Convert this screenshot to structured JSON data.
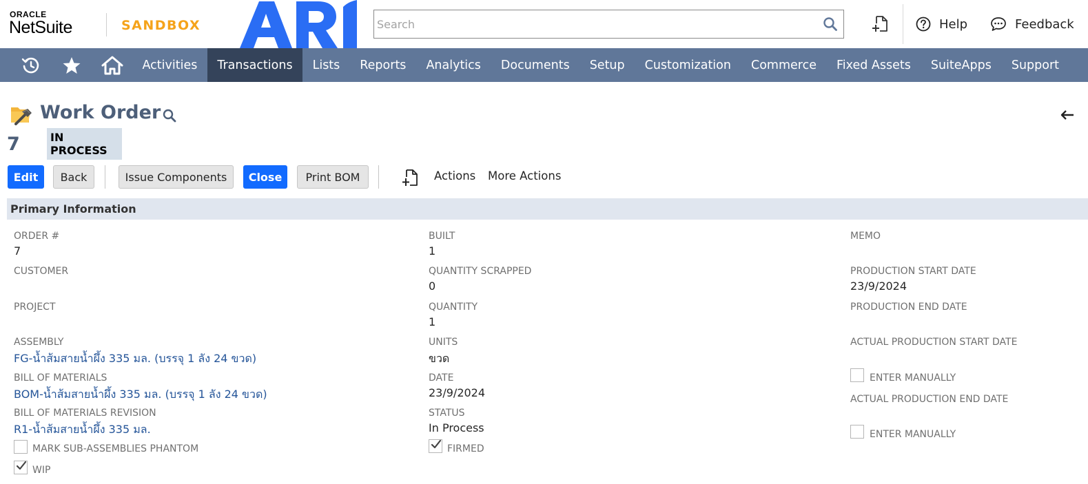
{
  "header": {
    "oracle_label": "ORACLE",
    "netsuite_label": "NetSuite",
    "sandbox_label": "SANDBOX",
    "brand_logo": "ARI",
    "search_placeholder": "Search",
    "help_label": "Help",
    "feedback_label": "Feedback"
  },
  "nav": {
    "items": [
      "Activities",
      "Transactions",
      "Lists",
      "Reports",
      "Analytics",
      "Documents",
      "Setup",
      "Customization",
      "Commerce",
      "Fixed Assets",
      "SuiteApps",
      "Support"
    ],
    "active": "Transactions"
  },
  "page": {
    "title": "Work Order",
    "record_number": "7",
    "status": "IN PROCESS"
  },
  "buttons": {
    "edit": "Edit",
    "back": "Back",
    "issue_components": "Issue Components",
    "close": "Close",
    "print_bom": "Print BOM",
    "actions": "Actions",
    "more_actions": "More Actions"
  },
  "section": {
    "title": "Primary Information"
  },
  "fields": {
    "order_number": {
      "label": "ORDER #",
      "value": "7"
    },
    "customer": {
      "label": "CUSTOMER",
      "value": ""
    },
    "project": {
      "label": "PROJECT",
      "value": ""
    },
    "assembly": {
      "label": "ASSEMBLY",
      "value": "FG-น้ำส้มสายน้ำผึ้ง 335 มล. (บรรจุ 1 ลัง 24 ขวด)"
    },
    "bill_of_materials": {
      "label": "BILL OF MATERIALS",
      "value": "BOM-น้ำส้มสายน้ำผึ้ง 335 มล. (บรรจุ 1 ลัง 24 ขวด)"
    },
    "bom_revision": {
      "label": "BILL OF MATERIALS REVISION",
      "value": "R1-น้ำส้มสายน้ำผึ้ง 335 มล."
    },
    "mark_phantom": {
      "label": "MARK SUB-ASSEMBLIES PHANTOM",
      "checked": false
    },
    "wip": {
      "label": "WIP",
      "checked": true
    },
    "built": {
      "label": "BUILT",
      "value": "1"
    },
    "quantity_scrapped": {
      "label": "QUANTITY SCRAPPED",
      "value": "0"
    },
    "quantity": {
      "label": "QUANTITY",
      "value": "1"
    },
    "units": {
      "label": "UNITS",
      "value": "ขวด"
    },
    "date": {
      "label": "DATE",
      "value": "23/9/2024"
    },
    "status": {
      "label": "STATUS",
      "value": "In Process"
    },
    "firmed": {
      "label": "FIRMED",
      "checked": true
    },
    "memo": {
      "label": "MEMO",
      "value": ""
    },
    "production_start": {
      "label": "PRODUCTION START DATE",
      "value": "23/9/2024"
    },
    "production_end": {
      "label": "PRODUCTION END DATE",
      "value": ""
    },
    "actual_start": {
      "label": "ACTUAL PRODUCTION START DATE",
      "value": ""
    },
    "actual_start_manual": {
      "label": "ENTER MANUALLY",
      "checked": false
    },
    "actual_end": {
      "label": "ACTUAL PRODUCTION END DATE",
      "value": ""
    },
    "actual_end_manual": {
      "label": "ENTER MANUALLY",
      "checked": false
    }
  },
  "colors": {
    "nav_background": "#607799",
    "nav_active": "#34435a",
    "primary_button": "#126bff",
    "sandbox": "#f5a31a",
    "ari_logo": "#2a6df4",
    "link": "#255599"
  },
  "icons": [
    "search-icon",
    "new-record-icon",
    "help-icon",
    "feedback-icon",
    "recent-records-icon",
    "star-icon",
    "home-icon",
    "work-order-icon",
    "back-arrow-icon",
    "checkmark-icon"
  ]
}
